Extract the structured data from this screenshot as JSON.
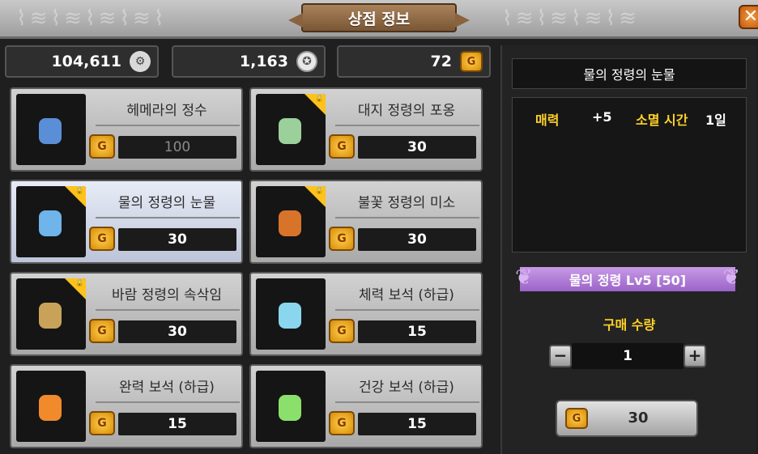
{
  "window": {
    "title": "상점 정보"
  },
  "currency": [
    {
      "value": "104,611",
      "icon": "gear-coin-icon"
    },
    {
      "value": "1,163",
      "icon": "silver-medal-icon"
    },
    {
      "value": "72",
      "icon": "gold-coin-icon"
    }
  ],
  "items": [
    {
      "name": "헤메라의 정수",
      "price": "100",
      "locked": false,
      "selected": false,
      "art_color": "#5a8fd8"
    },
    {
      "name": "대지 정령의 포옹",
      "price": "30",
      "locked": true,
      "selected": false,
      "art_color": "#9bd09b"
    },
    {
      "name": "물의 정령의 눈물",
      "price": "30",
      "locked": true,
      "selected": true,
      "art_color": "#6fb4ea"
    },
    {
      "name": "불꽃 정령의 미소",
      "price": "30",
      "locked": true,
      "selected": false,
      "art_color": "#d8742a"
    },
    {
      "name": "바람 정령의 속삭임",
      "price": "30",
      "locked": true,
      "selected": false,
      "art_color": "#c9a25a"
    },
    {
      "name": "체력 보석 (하급)",
      "price": "15",
      "locked": false,
      "selected": false,
      "art_color": "#8ad6ee"
    },
    {
      "name": "완력 보석 (하급)",
      "price": "15",
      "locked": false,
      "selected": false,
      "art_color": "#f08a2a"
    },
    {
      "name": "건강 보석 (하급)",
      "price": "15",
      "locked": false,
      "selected": false,
      "art_color": "#8ae06a"
    }
  ],
  "detail": {
    "title": "물의 정령의 눈물",
    "stat_name": "매력",
    "stat_value": "+5",
    "duration_label": "소멸 시간",
    "duration_value": "1일",
    "requirement": "물의 정령 Lv5 [50]",
    "quantity_label": "구매 수량",
    "quantity": "1",
    "minus": "−",
    "plus": "+",
    "buy_price": "30"
  }
}
